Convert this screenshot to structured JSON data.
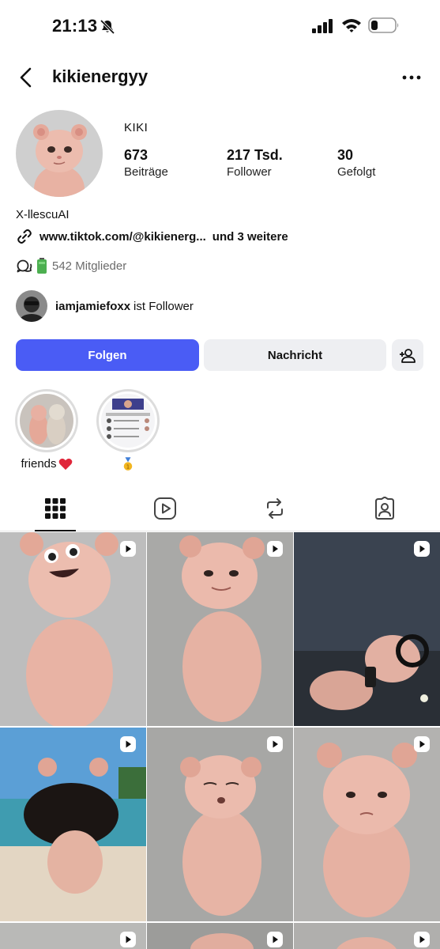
{
  "status_bar": {
    "time": "21:13"
  },
  "header": {
    "username": "kikienergyy"
  },
  "profile": {
    "display_name": "KIKI",
    "stats": {
      "posts": {
        "value": "673",
        "label": "Beiträge"
      },
      "followers": {
        "value": "217 Tsd.",
        "label": "Follower"
      },
      "following": {
        "value": "30",
        "label": "Gefolgt"
      }
    },
    "bio": "X-llescuAI",
    "link": "www.tiktok.com/@kikienerg...",
    "link_more": "und 3 weitere",
    "channel_members": "542 Mitglieder",
    "followed_by": {
      "name": "iamjamiefoxx",
      "suffix": "ist Follower"
    }
  },
  "actions": {
    "follow": "Folgen",
    "message": "Nachricht"
  },
  "highlights": [
    {
      "label": "friends"
    },
    {
      "label": ""
    }
  ],
  "colors": {
    "accent": "#4a5cf5",
    "secondary_button": "#eeeff2"
  }
}
